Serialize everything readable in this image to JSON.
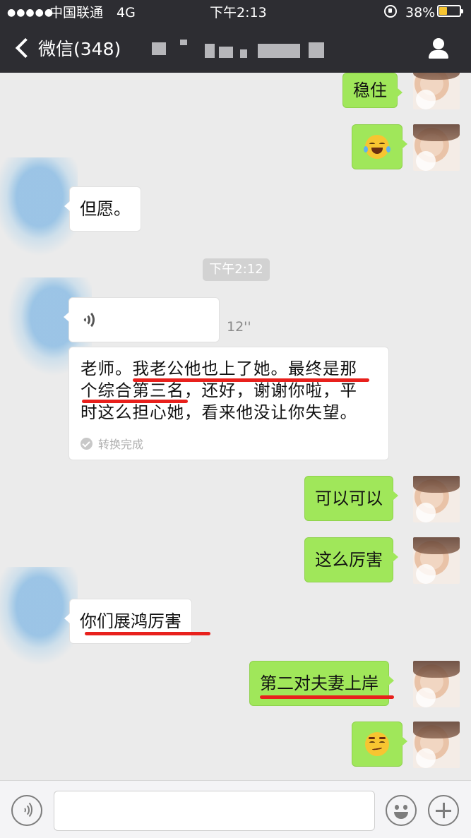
{
  "status_bar": {
    "signal": "●●●●●",
    "carrier": "中国联通",
    "network": "4G",
    "time": "下午2:13",
    "battery": "38%",
    "battery_level": 0.38,
    "battery_color": "#f7c531"
  },
  "nav": {
    "back_label": "微信(348)",
    "title": "",
    "contact_icon": "person-icon"
  },
  "colors": {
    "header_bg": "#2d2d32",
    "chat_bg": "#ebebeb",
    "outgoing_bubble": "#a0e75a",
    "incoming_bubble": "#ffffff",
    "highlight_red": "#e8201c"
  },
  "messages": [
    {
      "direction": "out",
      "type": "text",
      "text": "稳住"
    },
    {
      "direction": "out",
      "type": "emoji",
      "emoji": "tears-of-joy-emoji"
    },
    {
      "direction": "in",
      "type": "text",
      "text": "但愿。"
    },
    {
      "type": "timestamp",
      "text": "下午2:12"
    },
    {
      "direction": "in",
      "type": "voice",
      "duration": "12''"
    },
    {
      "direction": "in",
      "type": "transcript",
      "text": "老师。我老公他也上了她。最终是那\n个综合第三名，还好，谢谢你啦，平\n时这么担心她，看来他没让你失望。",
      "status": "转换完成"
    },
    {
      "direction": "out",
      "type": "text",
      "text": "可以可以"
    },
    {
      "direction": "out",
      "type": "text",
      "text": "这么厉害"
    },
    {
      "direction": "in",
      "type": "text",
      "text": "你们展鸿厉害"
    },
    {
      "direction": "out",
      "type": "text",
      "text": "第二对夫妻上岸"
    },
    {
      "direction": "out",
      "type": "emoji",
      "emoji": "smirk-emoji"
    }
  ],
  "input_bar": {
    "voice_toggle_icon": "voice-icon",
    "placeholder": "",
    "emoji_icon": "emoji-icon",
    "more_icon": "plus-icon"
  }
}
